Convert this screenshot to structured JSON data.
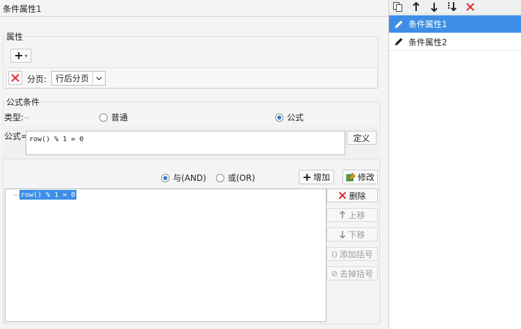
{
  "title": "条件属性1",
  "properties": {
    "legend": "属性",
    "add_label": "+",
    "page_label": "分页:",
    "page_value": "行后分页"
  },
  "formula_section": {
    "legend": "公式条件",
    "type_label": "类型:",
    "type_options": [
      "普通",
      "公式"
    ],
    "type_selected": "公式",
    "formula_label": "公式=",
    "formula_value": "row() % 1 = 0",
    "define_label": "定义"
  },
  "logic": {
    "and_label": "与(AND)",
    "or_label": "或(OR)",
    "selected": "and",
    "add_label": "增加",
    "modify_label": "修改"
  },
  "tree": {
    "items": [
      "row() % 1 = 0"
    ]
  },
  "side_buttons": {
    "delete": "删除",
    "move_up": "上移",
    "move_down": "下移",
    "add_bracket": "添加括号",
    "remove_bracket": "去掉括号"
  },
  "conditions": {
    "items": [
      "条件属性1",
      "条件属性2"
    ],
    "selected_index": 0
  },
  "colors": {
    "accent": "#3e8ee7",
    "delete_red": "#e03030",
    "panel_bg": "#f4f4f6"
  }
}
